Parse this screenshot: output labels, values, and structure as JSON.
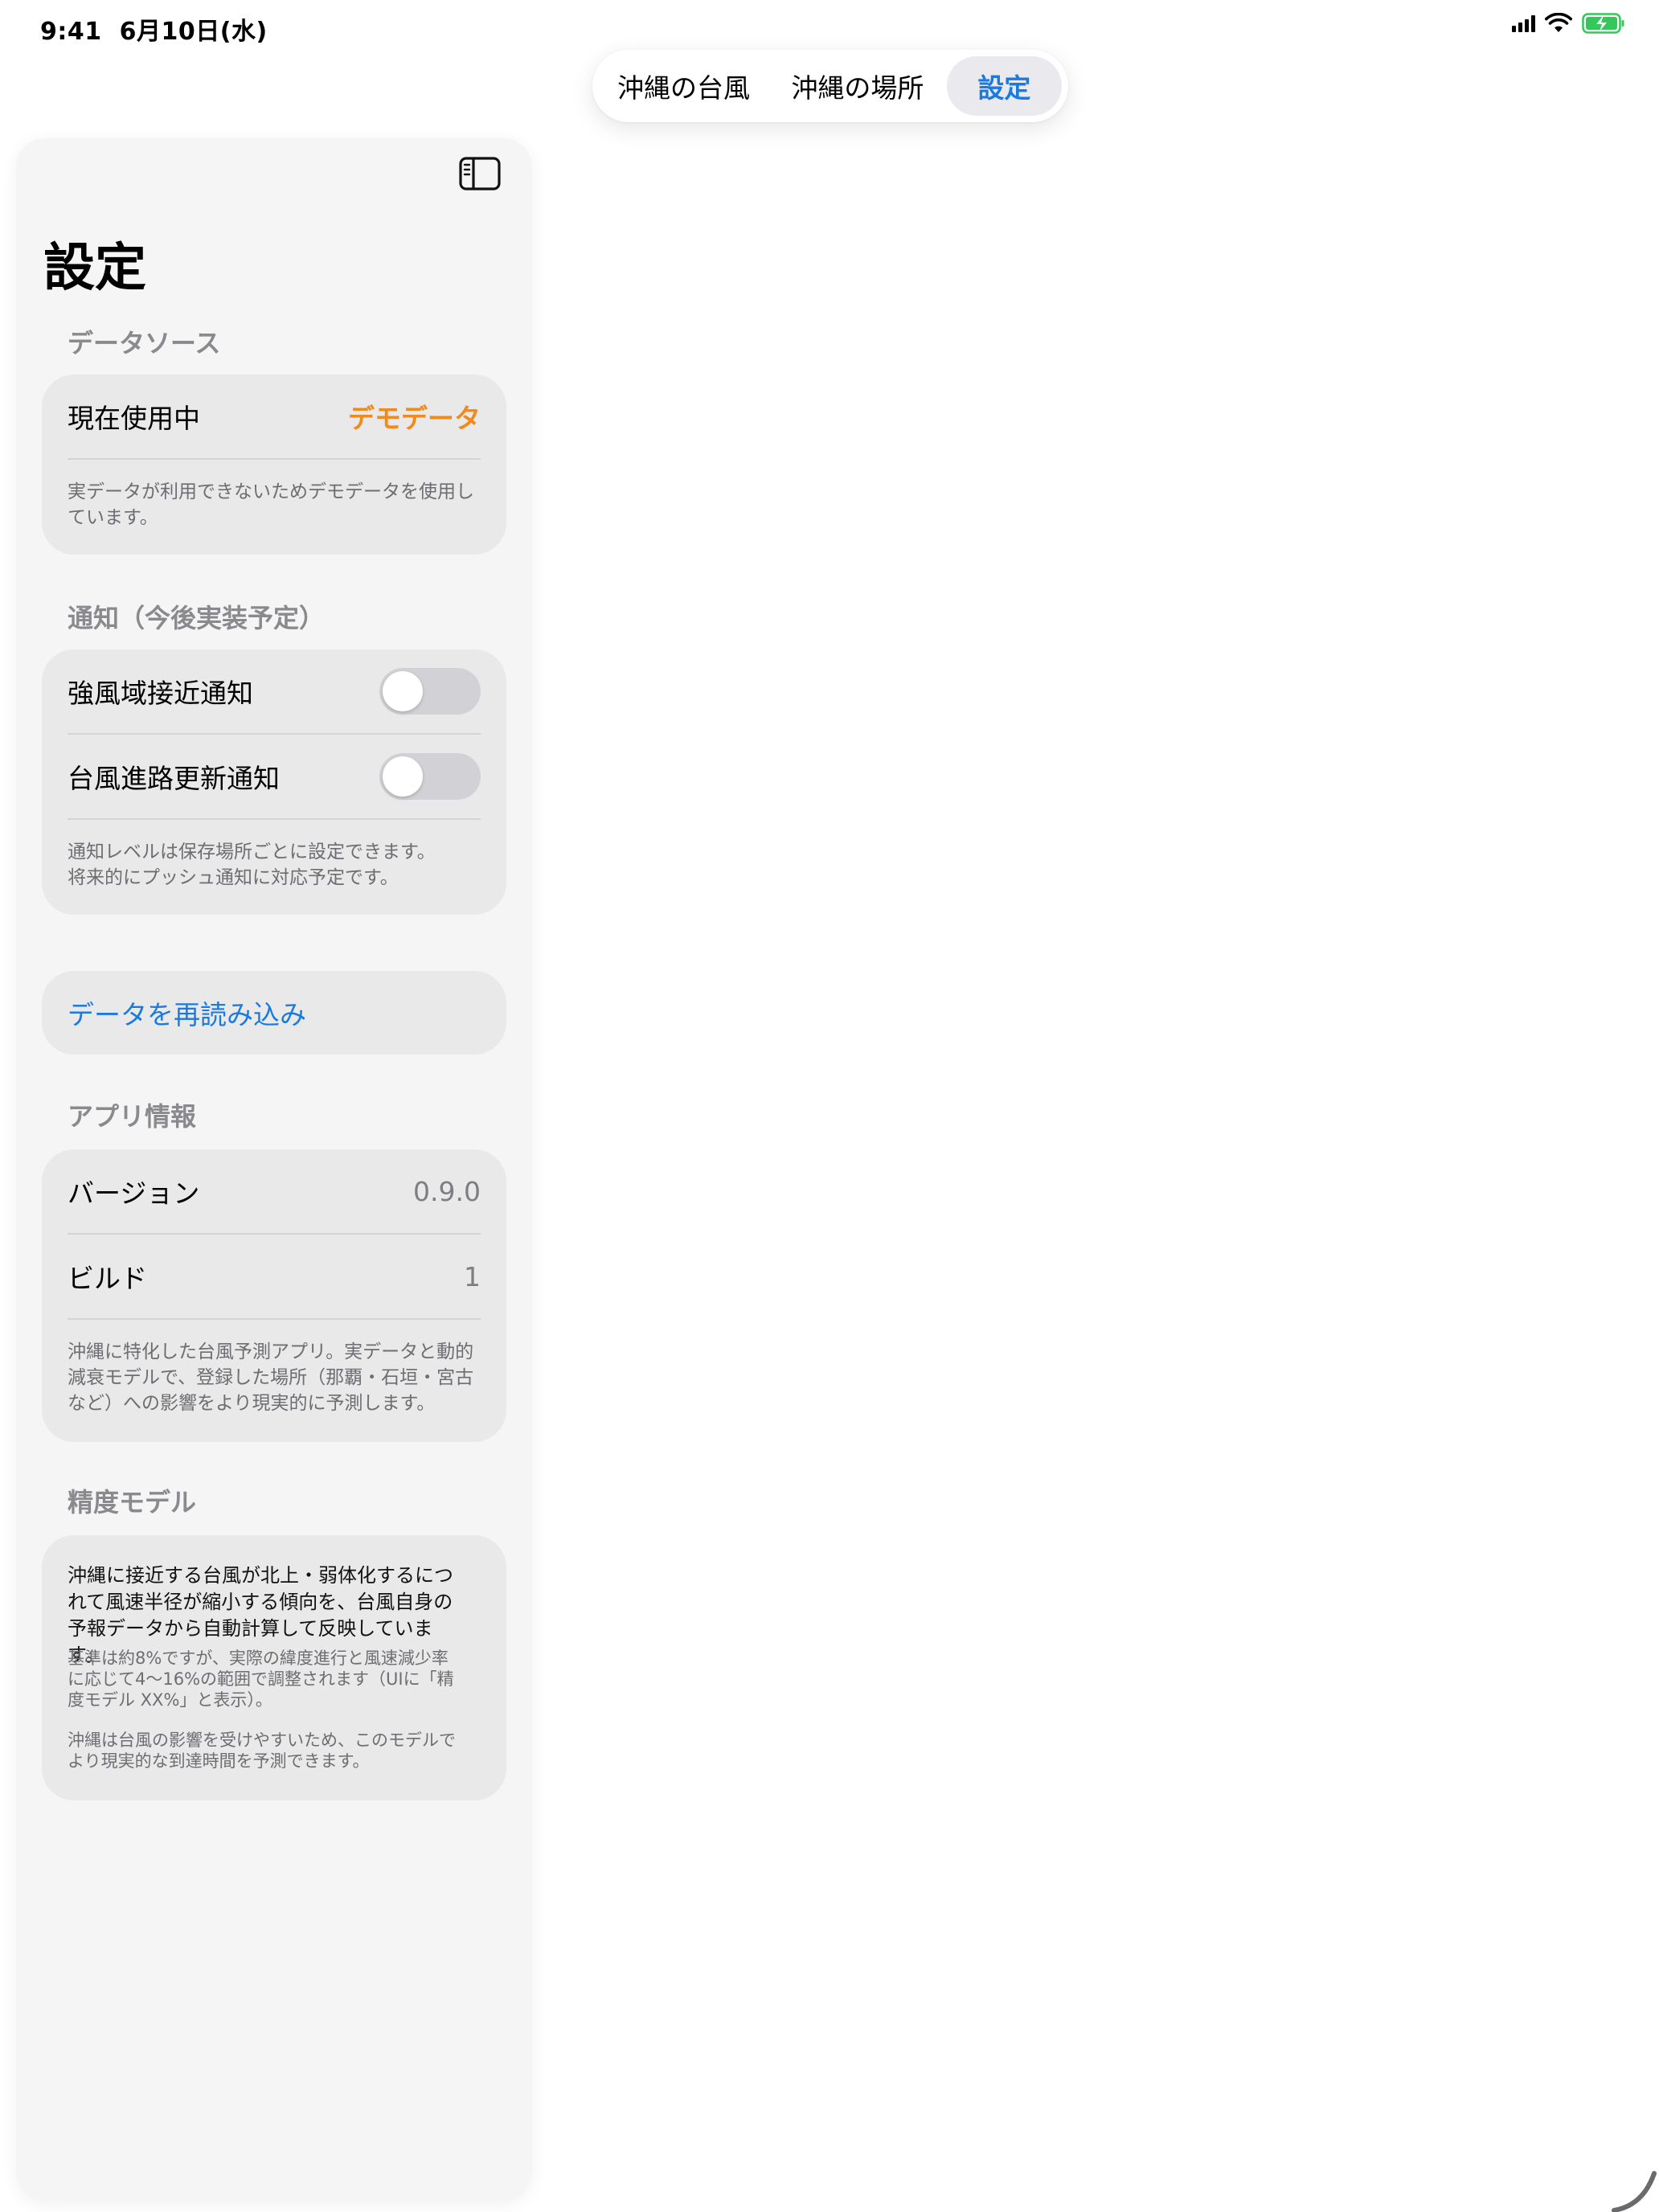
{
  "status_bar": {
    "time": "9:41",
    "date": "6月10日(水)"
  },
  "tabs": [
    {
      "label": "沖縄の台風",
      "selected": false
    },
    {
      "label": "沖縄の場所",
      "selected": false
    },
    {
      "label": "設定",
      "selected": true
    }
  ],
  "colors": {
    "accent": "#1a7ae0",
    "warning": "#f08a1c",
    "battery_green": "#34c759"
  },
  "sidebar": {
    "title": "設定",
    "sections": {
      "data_source": {
        "header": "データソース",
        "row_label": "現在使用中",
        "row_value": "デモデータ",
        "footnote": "実データが利用できないためデモデータを使用しています。"
      },
      "notifications": {
        "header": "通知（今後実装予定）",
        "toggles": [
          {
            "label": "強風域接近通知",
            "on": false
          },
          {
            "label": "台風進路更新通知",
            "on": false
          }
        ],
        "footnote_line1": "通知レベルは保存場所ごとに設定できます。",
        "footnote_line2": "将来的にプッシュ通知に対応予定です。"
      },
      "reload": {
        "label": "データを再読み込み"
      },
      "app_info": {
        "header": "アプリ情報",
        "version_label": "バージョン",
        "version_value": "0.9.0",
        "build_label": "ビルド",
        "build_value": "1",
        "footnote": "沖縄に特化した台風予測アプリ。実データと動的減衰モデルで、登録した場所（那覇・石垣・宮古など）への影響をより現実的に予測します。"
      },
      "accuracy_model": {
        "header": "精度モデル",
        "main": "沖縄に接近する台風が北上・弱体化するにつれて風速半径が縮小する傾向を、台風自身の予報データから自動計算して反映しています。",
        "sub1": "基準は約8%ですが、実際の緯度進行と風速減少率に応じて4〜16%の範囲で調整されます（UIに「精度モデル XX%」と表示）。",
        "sub2": "沖縄は台風の影響を受けやすいため、このモデルでより現実的な到達時間を予測できます。"
      }
    }
  }
}
